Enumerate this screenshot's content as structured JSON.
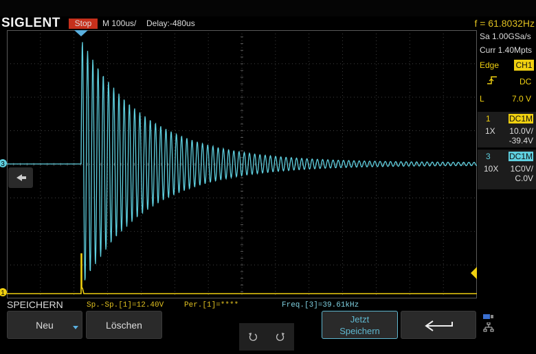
{
  "header": {
    "brand": "SIGLENT",
    "run_status": "Stop",
    "timebase": "M 100us/",
    "delay": "Delay:-480us",
    "frequency": "f = 61.8032Hz"
  },
  "acquisition": {
    "sample_rate": "Sa 1.00GSa/s",
    "memory_depth": "Curr 1.40Mpts"
  },
  "trigger": {
    "type": "Edge",
    "source": "CH1",
    "coupling": "DC",
    "level_label": "L",
    "level": "7.0 V"
  },
  "channels": [
    {
      "number": "1",
      "coupling": "DC1M",
      "probe": "1X",
      "scale": "10.0V/",
      "offset": "-39.4V",
      "color": "#f0d010"
    },
    {
      "number": "3",
      "coupling": "DC1M",
      "probe": "10X",
      "scale": "1C0V/",
      "offset": "C.0V",
      "color": "#5fd0e0"
    }
  ],
  "markers": {
    "ch3": "3",
    "ch1": "1"
  },
  "menu": {
    "title": "SPEICHERN",
    "neu_label": "Neu",
    "loeschen_label": "Löschen",
    "speichern_line1": "Jetzt",
    "speichern_line2": "Speichern"
  },
  "measurements": {
    "peak_to_peak": "Sp.-Sp.[1]=12.40V",
    "period": "Per.[1]=****",
    "frequency": "Freq.[3]=39.61kHz"
  },
  "colors": {
    "ch1": "#f0d010",
    "ch3": "#5fd0e0",
    "grid": "#5a5a5a",
    "stop": "#c6301c"
  }
}
